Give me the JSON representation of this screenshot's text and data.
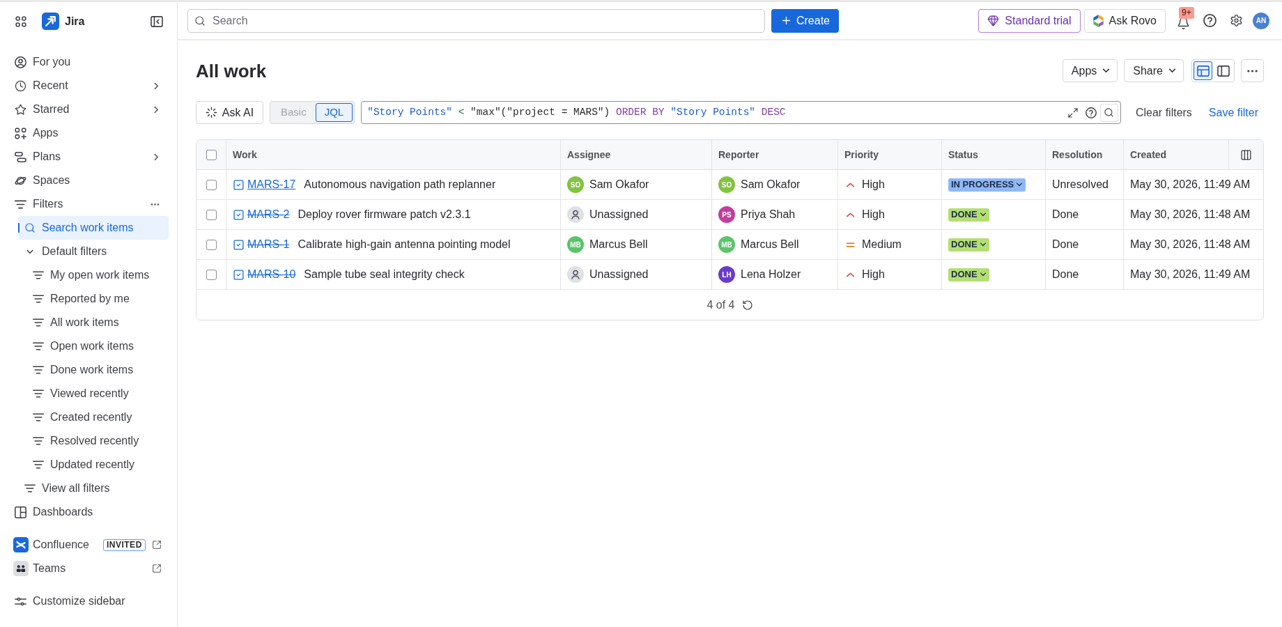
{
  "sidebar": {
    "product": "Jira",
    "items": [
      {
        "label": "For you",
        "selected": false,
        "submenu": false,
        "more_actions": false
      },
      {
        "label": "Recent",
        "selected": false,
        "submenu": true,
        "more_actions": false
      },
      {
        "label": "Starred",
        "selected": false,
        "submenu": true,
        "more_actions": false
      },
      {
        "label": "Apps",
        "selected": false,
        "submenu": false,
        "more_actions": false
      },
      {
        "label": "Plans",
        "selected": false,
        "submenu": true,
        "more_actions": false
      },
      {
        "label": "Spaces",
        "selected": false,
        "submenu": false,
        "more_actions": false
      },
      {
        "label": "Filters",
        "selected": false,
        "submenu": false,
        "more_actions": true,
        "children": [
          {
            "kind": "search",
            "label": "Search work items",
            "selected": true
          },
          {
            "kind": "group",
            "label": "Default filters",
            "selected": false,
            "expanded": true,
            "children": [
              {
                "kind": "filter",
                "label": "My open work items",
                "selected": false
              },
              {
                "kind": "filter",
                "label": "Reported by me",
                "selected": false
              },
              {
                "kind": "filter",
                "label": "All work items",
                "selected": false
              },
              {
                "kind": "filter",
                "label": "Open work items",
                "selected": false
              },
              {
                "kind": "filter",
                "label": "Done work items",
                "selected": false
              },
              {
                "kind": "filter",
                "label": "Viewed recently",
                "selected": false
              },
              {
                "kind": "filter",
                "label": "Created recently",
                "selected": false
              },
              {
                "kind": "filter",
                "label": "Resolved recently",
                "selected": false
              },
              {
                "kind": "filter",
                "label": "Updated recently",
                "selected": false
              }
            ]
          },
          {
            "kind": "filter",
            "label": "View all filters",
            "selected": false
          }
        ]
      },
      {
        "label": "Dashboards",
        "selected": false,
        "submenu": false,
        "more_actions": false
      }
    ],
    "apps": [
      {
        "label": "Confluence",
        "badge": "INVITED",
        "external": true
      },
      {
        "label": "Teams",
        "external": true
      }
    ],
    "customize": "Customize sidebar"
  },
  "top_bar": {
    "search": {
      "placeholder": "Search"
    },
    "create_button": "Create",
    "trial_button": "Standard trial",
    "rovo_button": "Ask Rovo",
    "notification_count": "9+",
    "avatar_initials": "AN"
  },
  "page": {
    "title": "All work",
    "apps_button": "Apps",
    "share_button": "Share",
    "views": [
      {
        "kind": "list",
        "selected": true
      },
      {
        "kind": "detail",
        "selected": false
      }
    ]
  },
  "filter_bar": {
    "ask_ai_button": "Ask AI",
    "modes": [
      {
        "label": "Basic",
        "selected": false
      },
      {
        "label": "JQL",
        "selected": true
      }
    ],
    "query": [
      {
        "kind": "field",
        "text": "\"Story Points\""
      },
      {
        "kind": "operator",
        "text": "<"
      },
      {
        "kind": "function",
        "text": "\"max\"(\"project = MARS\")"
      },
      {
        "kind": "keyword",
        "text": "ORDER BY"
      },
      {
        "kind": "field",
        "text": "\"Story Points\""
      },
      {
        "kind": "keyword",
        "text": "DESC"
      }
    ],
    "clear_filters": "Clear filters",
    "save_filter": "Save filter"
  },
  "table": {
    "select_all": {
      "checked": false
    },
    "columns": [
      "Work",
      "Assignee",
      "Reporter",
      "Priority",
      "Status",
      "Resolution",
      "Created"
    ],
    "rows": [
      {
        "checked": false,
        "key": "MARS-17",
        "resolved": false,
        "summary": "Autonomous navigation path replanner",
        "assignee": {
          "initials": "SO",
          "name": "Sam Okafor",
          "color": "#82c341"
        },
        "reporter": {
          "initials": "SO",
          "name": "Sam Okafor",
          "color": "#82c341"
        },
        "priority": {
          "kind": "high",
          "label": "High"
        },
        "status": {
          "kind": "in_progress",
          "label": "IN PROGRESS"
        },
        "resolution": "Unresolved",
        "created": "May 30, 2026, 11:49 AM"
      },
      {
        "checked": false,
        "key": "MARS-2",
        "resolved": true,
        "summary": "Deploy rover firmware patch v2.3.1",
        "assignee": {
          "name": "Unassigned"
        },
        "reporter": {
          "initials": "PS",
          "name": "Priya Shah",
          "color": "#c13e9c"
        },
        "priority": {
          "kind": "high",
          "label": "High"
        },
        "status": {
          "kind": "done",
          "label": "DONE"
        },
        "resolution": "Done",
        "created": "May 30, 2026, 11:48 AM"
      },
      {
        "checked": false,
        "key": "MARS-1",
        "resolved": true,
        "summary": "Calibrate high-gain antenna pointing model",
        "assignee": {
          "initials": "MB",
          "name": "Marcus Bell",
          "color": "#5bc46b"
        },
        "reporter": {
          "initials": "MB",
          "name": "Marcus Bell",
          "color": "#5bc46b"
        },
        "priority": {
          "kind": "medium",
          "label": "Medium"
        },
        "status": {
          "kind": "done",
          "label": "DONE"
        },
        "resolution": "Done",
        "created": "May 30, 2026, 11:48 AM"
      },
      {
        "checked": false,
        "key": "MARS-10",
        "resolved": true,
        "summary": "Sample tube seal integrity check",
        "assignee": {
          "name": "Unassigned"
        },
        "reporter": {
          "initials": "LH",
          "name": "Lena Holzer",
          "color": "#6a3cc9"
        },
        "priority": {
          "kind": "high",
          "label": "High"
        },
        "status": {
          "kind": "done",
          "label": "DONE"
        },
        "resolution": "Done",
        "created": "May 30, 2026, 11:49 AM"
      }
    ],
    "footer": {
      "count": "4 of 4"
    }
  }
}
